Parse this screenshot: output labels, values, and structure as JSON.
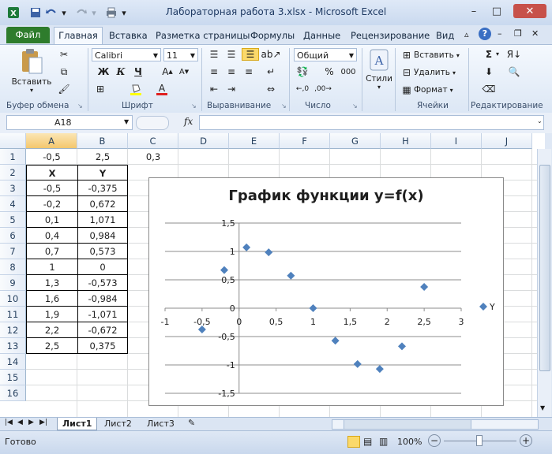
{
  "window": {
    "title": "Лабораторная работа 3.xlsx - Microsoft Excel",
    "minimize": "–",
    "maximize": "□",
    "close": "✕"
  },
  "tabs": [
    "Файл",
    "Главная",
    "Вставка",
    "Разметка страницы",
    "Формулы",
    "Данные",
    "Рецензирование",
    "Вид"
  ],
  "ribbon": {
    "paste": "Вставить",
    "clipboard_group": "Буфер обмена",
    "font_name": "Calibri",
    "font_size": "11",
    "bold": "Ж",
    "italic": "К",
    "underline": "Ч",
    "font_group": "Шрифт",
    "align_group": "Выравнивание",
    "number_format": "Общий",
    "percent": "%",
    "thousands": "000",
    "number_group": "Число",
    "styles": "Стили",
    "insert_cells": "Вставить",
    "delete_cells": "Удалить",
    "format_cells": "Формат",
    "cells_group": "Ячейки",
    "editing_group": "Редактирование"
  },
  "formula_bar": {
    "name_box": "A18",
    "fx": "fx",
    "value": ""
  },
  "sheet": {
    "columns": [
      "A",
      "B",
      "C",
      "D",
      "E",
      "F",
      "G",
      "H",
      "I",
      "J"
    ],
    "rows": [
      "1",
      "2",
      "3",
      "4",
      "5",
      "6",
      "7",
      "8",
      "9",
      "10",
      "11",
      "12",
      "13",
      "14",
      "15",
      "16"
    ],
    "row1": {
      "A": "-0,5",
      "B": "2,5",
      "C": "0,3"
    },
    "header": {
      "x": "X",
      "y": "Y"
    },
    "table": [
      [
        "-0,5",
        "-0,375"
      ],
      [
        "-0,2",
        "0,672"
      ],
      [
        "0,1",
        "1,071"
      ],
      [
        "0,4",
        "0,984"
      ],
      [
        "0,7",
        "0,573"
      ],
      [
        "1",
        "0"
      ],
      [
        "1,3",
        "-0,573"
      ],
      [
        "1,6",
        "-0,984"
      ],
      [
        "1,9",
        "-1,071"
      ],
      [
        "2,2",
        "-0,672"
      ],
      [
        "2,5",
        "0,375"
      ]
    ]
  },
  "chart_data": {
    "type": "scatter",
    "title": "График функции y=f(x)",
    "legend": "Y",
    "legend_position": "right",
    "xlim": [
      -1,
      3
    ],
    "ylim": [
      -1.5,
      1.5
    ],
    "x_ticks": [
      "-1",
      "-0,5",
      "0",
      "0,5",
      "1",
      "1,5",
      "2",
      "2,5",
      "3"
    ],
    "y_ticks": [
      "1,5",
      "1",
      "0,5",
      "0",
      "-0,5",
      "-1",
      "-1,5"
    ],
    "grid": "horizontal",
    "color": "#4f81bd",
    "series": [
      {
        "name": "Y",
        "x": [
          -0.5,
          -0.2,
          0.1,
          0.4,
          0.7,
          1.0,
          1.3,
          1.6,
          1.9,
          2.2,
          2.5
        ],
        "y": [
          -0.375,
          0.672,
          1.071,
          0.984,
          0.573,
          0.0,
          -0.573,
          -0.984,
          -1.071,
          -0.672,
          0.375
        ]
      }
    ]
  },
  "sheet_tabs": [
    "Лист1",
    "Лист2",
    "Лист3"
  ],
  "status": {
    "ready": "Готово",
    "zoom": "100%",
    "zoom_out": "−",
    "zoom_in": "+"
  }
}
